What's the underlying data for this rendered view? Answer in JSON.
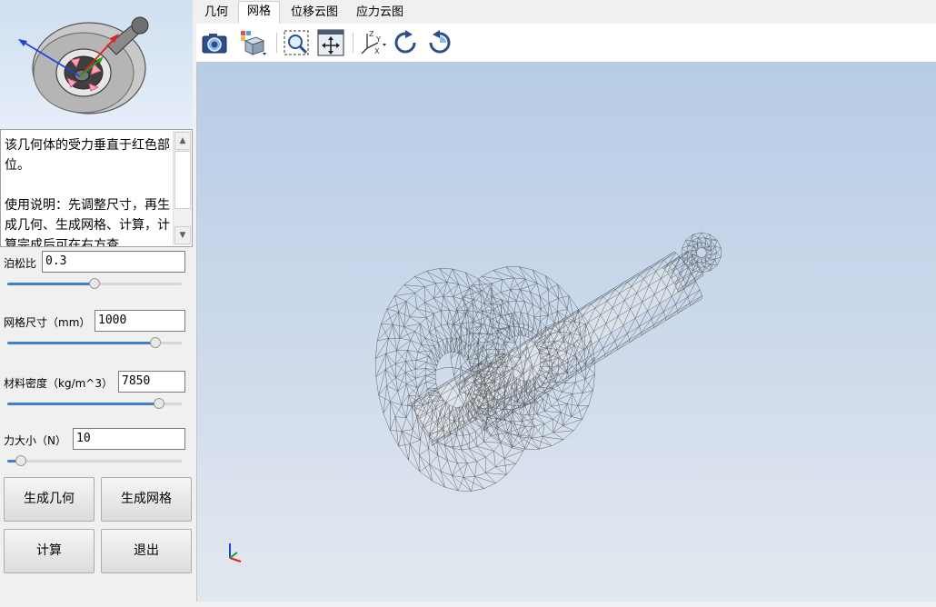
{
  "description": {
    "text": "该几何体的受力垂直于红色部位。\n\n使用说明：先调整尺寸，再生成几何、生成网格、计算，计算完成后可在右方查"
  },
  "params": {
    "poisson": {
      "label": "泊松比",
      "value": "0.3",
      "slider_fraction": 0.5
    },
    "mesh_size": {
      "label": "网格尺寸（mm）",
      "value": "1000",
      "slider_fraction": 0.85
    },
    "density": {
      "label": "材料密度（kg/m^3）",
      "value": "7850",
      "slider_fraction": 0.87
    },
    "force": {
      "label": "力大小（N）",
      "value": "10",
      "slider_fraction": 0.08
    }
  },
  "buttons": {
    "gen_geometry": "生成几何",
    "gen_mesh": "生成网格",
    "compute": "计算",
    "exit": "退出"
  },
  "tabs": [
    "几何",
    "网格",
    "位移云图",
    "应力云图"
  ],
  "active_tab": "网格",
  "toolbar_icons": [
    "camera-icon",
    "view-cube-icon",
    "zoom-window-icon",
    "fit-all-icon",
    "axis-triad-icon",
    "rotate-cw-icon",
    "rotate-ccw-icon"
  ],
  "colors": {
    "slider_fill": "#3d7fd0",
    "force_marker": "#ff9fb0",
    "axis_x": "#e02020",
    "axis_y": "#20a020",
    "axis_z": "#2040e0"
  }
}
